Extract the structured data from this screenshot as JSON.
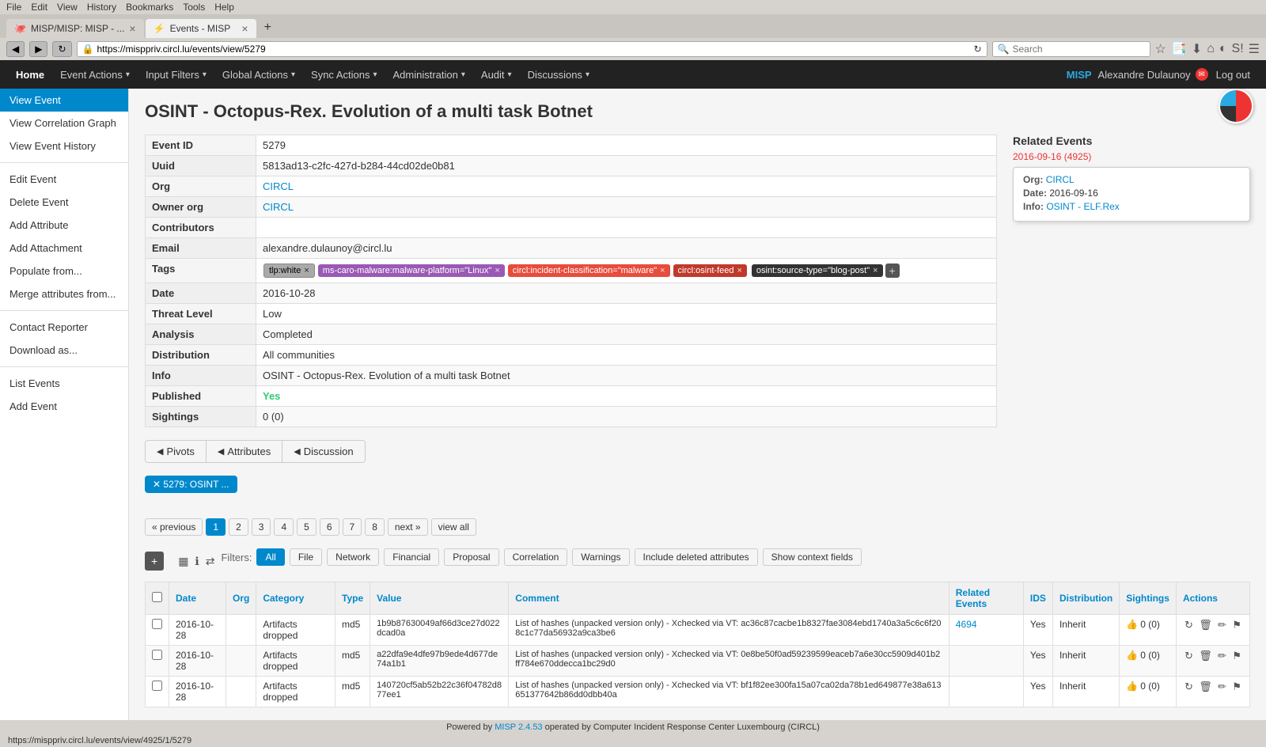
{
  "browser": {
    "menubar": [
      "File",
      "Edit",
      "View",
      "History",
      "Bookmarks",
      "Tools",
      "Help"
    ],
    "tabs": [
      {
        "id": "tab1",
        "favicon": "🐙",
        "title": "MISP/MISP: MISP - ...",
        "active": false
      },
      {
        "id": "tab2",
        "favicon": "⚡",
        "title": "Events - MISP",
        "active": true
      }
    ],
    "address": "https://misppriv.circl.lu/events/view/5279",
    "search_placeholder": "Search"
  },
  "nav": {
    "home": "Home",
    "items": [
      {
        "label": "Event Actions",
        "caret": "▾"
      },
      {
        "label": "Input Filters",
        "caret": "▾"
      },
      {
        "label": "Global Actions",
        "caret": "▾"
      },
      {
        "label": "Sync Actions",
        "caret": "▾"
      },
      {
        "label": "Administration",
        "caret": "▾"
      },
      {
        "label": "Audit",
        "caret": "▾"
      },
      {
        "label": "Discussions",
        "caret": "▾"
      }
    ],
    "brand": "MISP",
    "user": "Alexandre Dulaunoy",
    "logout": "Log out"
  },
  "sidebar": {
    "items": [
      {
        "label": "View Event",
        "active": true
      },
      {
        "label": "View Correlation Graph",
        "active": false
      },
      {
        "label": "View Event History",
        "active": false
      },
      {
        "label": "Edit Event",
        "active": false
      },
      {
        "label": "Delete Event",
        "active": false
      },
      {
        "label": "Add Attribute",
        "active": false
      },
      {
        "label": "Add Attachment",
        "active": false
      },
      {
        "label": "Populate from...",
        "active": false
      },
      {
        "label": "Merge attributes from...",
        "active": false
      },
      {
        "label": "Contact Reporter",
        "active": false
      },
      {
        "label": "Download as...",
        "active": false
      },
      {
        "label": "List Events",
        "active": false
      },
      {
        "label": "Add Event",
        "active": false
      }
    ]
  },
  "event": {
    "title": "OSINT - Octopus-Rex. Evolution of a multi task Botnet",
    "fields": [
      {
        "label": "Event ID",
        "value": "5279"
      },
      {
        "label": "Uuid",
        "value": "5813ad13-c2fc-427d-b284-44cd02de0b81"
      },
      {
        "label": "Org",
        "value": "CIRCL",
        "is_link": true
      },
      {
        "label": "Owner org",
        "value": "CIRCL",
        "is_link": true
      },
      {
        "label": "Contributors",
        "value": ""
      },
      {
        "label": "Email",
        "value": "alexandre.dulaunoy@circl.lu"
      },
      {
        "label": "Tags",
        "value": "tags"
      },
      {
        "label": "Date",
        "value": "2016-10-28"
      },
      {
        "label": "Threat Level",
        "value": "Low"
      },
      {
        "label": "Analysis",
        "value": "Completed"
      },
      {
        "label": "Distribution",
        "value": "All communities"
      },
      {
        "label": "Info",
        "value": "OSINT - Octopus-Rex. Evolution of a multi task Botnet"
      },
      {
        "label": "Published",
        "value": "Yes",
        "is_published": true
      },
      {
        "label": "Sightings",
        "value": "0 (0)"
      }
    ],
    "tags": [
      {
        "text": "tlp:white",
        "style": "white"
      },
      {
        "text": "ms-caro-malware:malware-platform=\"Linux\"",
        "style": "purple"
      },
      {
        "text": "circl:incident-classification=\"malware\"",
        "style": "red"
      },
      {
        "text": "circl:osint-feed",
        "style": "pink"
      },
      {
        "text": "osint:source-type=\"blog-post\"",
        "style": "dark"
      }
    ]
  },
  "related_events": {
    "label": "Related Events",
    "link_text": "2016-09-16 (4925)",
    "link_url": "#",
    "popup": {
      "org_label": "Org:",
      "org_value": "CIRCL",
      "date_label": "Date:",
      "date_value": "2016-09-16",
      "info_label": "Info:",
      "info_value": "OSINT - ELF.Rex",
      "info_url": "#"
    }
  },
  "tabs": {
    "items": [
      {
        "label": "Pivots",
        "icon": "◀"
      },
      {
        "label": "Attributes",
        "icon": "◀"
      },
      {
        "label": "Discussion",
        "icon": "◀"
      }
    ]
  },
  "pivot": {
    "label": "✕ 5279: OSINT ..."
  },
  "pagination": {
    "prev": "« previous",
    "pages": [
      "1",
      "2",
      "3",
      "4",
      "5",
      "6",
      "7",
      "8"
    ],
    "next": "next »",
    "view_all": "view all",
    "active": "1"
  },
  "filters": {
    "label": "Filters:",
    "items": [
      {
        "label": "All",
        "active": true
      },
      {
        "label": "File",
        "active": false
      },
      {
        "label": "Network",
        "active": false
      },
      {
        "label": "Financial",
        "active": false
      },
      {
        "label": "Proposal",
        "active": false
      },
      {
        "label": "Correlation",
        "active": false
      },
      {
        "label": "Warnings",
        "active": false
      },
      {
        "label": "Include deleted attributes",
        "active": false
      },
      {
        "label": "Show context fields",
        "active": false
      }
    ]
  },
  "attributes_table": {
    "add_btn": "+",
    "columns": [
      "Date",
      "Org",
      "Category",
      "Type",
      "Value",
      "Comment",
      "Related Events",
      "IDS",
      "Distribution",
      "Sightings",
      "Actions"
    ],
    "rows": [
      {
        "date": "2016-10-28",
        "org": "",
        "category": "Artifacts dropped",
        "type": "md5",
        "value": "1b9b87630049af66d3ce27d022dcad0a",
        "comment": "List of hashes (unpacked version only) - Xchecked via VT: ac36c87cacbe1b8327fae3084ebd1740a3a5c6c6f208c1c77da56932a9ca3be6",
        "related_events": "4694",
        "ids": "Yes",
        "distribution": "Inherit",
        "sightings": "0 (0)"
      },
      {
        "date": "2016-10-28",
        "org": "",
        "category": "Artifacts dropped",
        "type": "md5",
        "value": "a22dfa9e4dfe97b9ede4d677de74a1b1",
        "comment": "List of hashes (unpacked version only) - Xchecked via VT: 0e8be50f0ad59239599eaceb7a6e30cc5909d401b2ff784e670ddecca1bc29d0",
        "related_events": "",
        "ids": "Yes",
        "distribution": "Inherit",
        "sightings": "0 (0)"
      },
      {
        "date": "2016-10-28",
        "org": "",
        "category": "Artifacts dropped",
        "type": "md5",
        "value": "140720cf5ab52b22c36f04782d877ee1",
        "comment": "List of hashes (unpacked version only) - Xchecked via VT: bf1f82ee300fa15a07ca02da78b1ed649877e38a613651377642b86dd0dbb40a",
        "related_events": "",
        "ids": "Yes",
        "distribution": "Inherit",
        "sightings": "0 (0)"
      }
    ]
  },
  "status_bar": {
    "text_before": "Powered by",
    "misp_version": "MISP 2.4.53",
    "text_after": "operated by Computer Incident Response Center Luxembourg (CIRCL)"
  }
}
